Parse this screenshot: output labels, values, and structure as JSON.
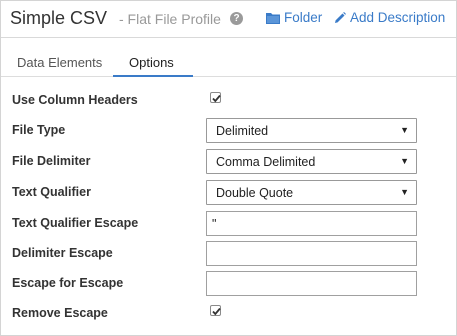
{
  "header": {
    "title": "Simple CSV",
    "subtitle": "- Flat File Profile",
    "help_icon": "?",
    "folder_label": "Folder",
    "description_label": "Add Description"
  },
  "tabs": [
    {
      "label": "Data Elements",
      "active": false
    },
    {
      "label": "Options",
      "active": true
    }
  ],
  "form": {
    "use_column_headers": {
      "label": "Use Column Headers",
      "checked": true
    },
    "file_type": {
      "label": "File Type",
      "value": "Delimited"
    },
    "file_delimiter": {
      "label": "File Delimiter",
      "value": "Comma Delimited"
    },
    "text_qualifier": {
      "label": "Text Qualifier",
      "value": "Double Quote"
    },
    "text_qualifier_escape": {
      "label": "Text Qualifier Escape",
      "value": "\""
    },
    "delimiter_escape": {
      "label": "Delimiter Escape",
      "value": ""
    },
    "escape_for_escape": {
      "label": "Escape for Escape",
      "value": ""
    },
    "remove_escape": {
      "label": "Remove Escape",
      "checked": true
    }
  },
  "colors": {
    "link": "#3a7bc8",
    "tab_underline": "#3a7bc8",
    "subtitle": "#999999"
  }
}
